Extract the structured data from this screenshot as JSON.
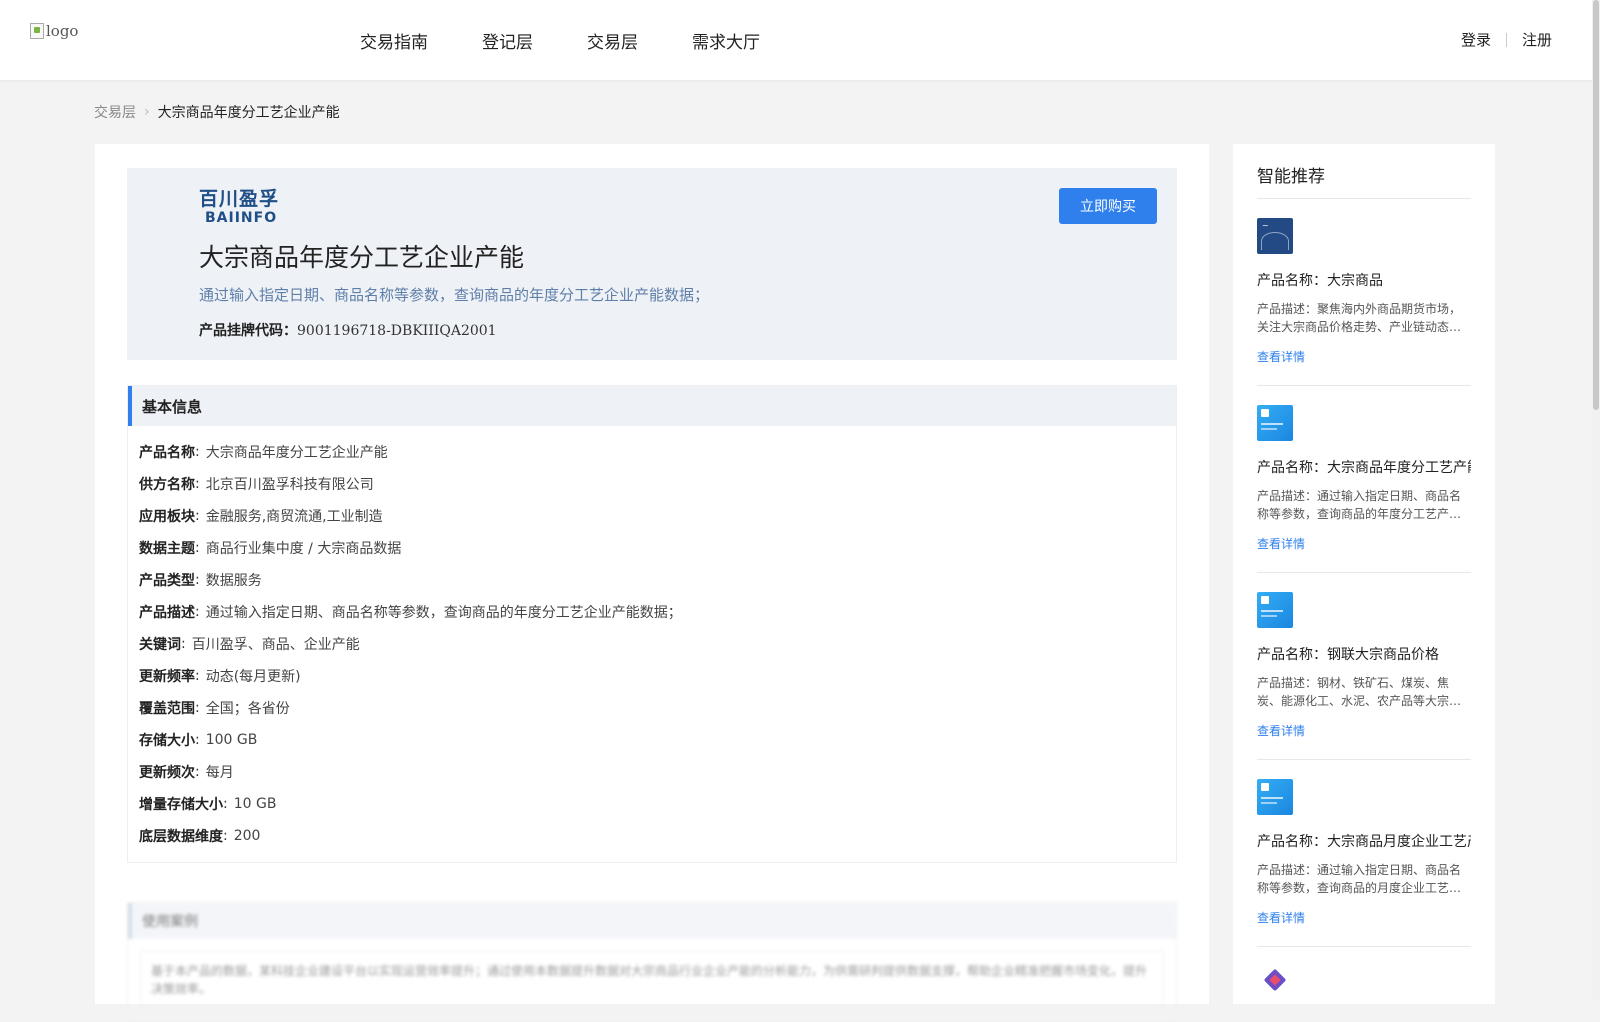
{
  "header": {
    "logo_alt": "logo",
    "nav": [
      "交易指南",
      "登记层",
      "交易层",
      "需求大厅"
    ],
    "login": "登录",
    "register": "注册"
  },
  "breadcrumb": {
    "parent": "交易层",
    "current": "大宗商品年度分工艺企业产能"
  },
  "product": {
    "brand_cn": "百川盈孚",
    "brand_en": "BAIINFO",
    "title": "大宗商品年度分工艺企业产能",
    "subtitle": "通过输入指定日期、商品名称等参数，查询商品的年度分工艺企业产能数据；",
    "code_label": "产品挂牌代码：",
    "code_value": "9001196718-DBKIIIQA2001",
    "buy_label": "立即购买"
  },
  "basic_info": {
    "title": "基本信息",
    "rows": [
      {
        "label": "产品名称",
        "value": "大宗商品年度分工艺企业产能"
      },
      {
        "label": "供方名称",
        "value": "北京百川盈孚科技有限公司"
      },
      {
        "label": "应用板块",
        "value": "金融服务,商贸流通,工业制造"
      },
      {
        "label": "数据主题",
        "value": "商品行业集中度 / 大宗商品数据"
      },
      {
        "label": "产品类型",
        "value": "数据服务"
      },
      {
        "label": "产品描述",
        "value": "通过输入指定日期、商品名称等参数，查询商品的年度分工艺企业产能数据；"
      },
      {
        "label": "关键词",
        "value": "百川盈孚、商品、企业产能"
      },
      {
        "label": "更新频率",
        "value": "动态(每月更新)"
      },
      {
        "label": "覆盖范围",
        "value": "全国；各省份"
      },
      {
        "label": "存储大小",
        "value": "100 GB"
      },
      {
        "label": "更新频次",
        "value": "每月"
      },
      {
        "label": "增量存储大小",
        "value": "10 GB"
      },
      {
        "label": "底层数据维度",
        "value": "200"
      }
    ]
  },
  "usage_section": {
    "title": "使用案例",
    "text": "基于本产品的数据，某科技企业建设平台以实现运营效率提升；通过使用本数据提升数据对大宗商品行业企业产能的分析能力，为供需研判提供数据支撑，帮助企业精准把握市场变化，提升决策效率。"
  },
  "sidebar": {
    "title": "智能推荐",
    "more_label": "查看详情",
    "items": [
      {
        "name": "产品名称：大宗商品",
        "desc": "产品描述：聚焦海内外商品期货市场，关注大宗商品价格走势、产业链动态…",
        "thumb": "dark"
      },
      {
        "name": "产品名称：大宗商品年度分工艺产能",
        "desc": "产品描述：通过输入指定日期、商品名称等参数，查询商品的年度分工艺产…",
        "thumb": "blue"
      },
      {
        "name": "产品名称：钢联大宗商品价格",
        "desc": "产品描述：钢材、铁矿石、煤炭、焦炭、能源化工、水泥、农产品等大宗…",
        "thumb": "blue"
      },
      {
        "name": "产品名称：大宗商品月度企业工艺产能",
        "desc": "产品描述：通过输入指定日期、商品名称等参数，查询商品的月度企业工艺…",
        "thumb": "blue"
      }
    ]
  },
  "colors": {
    "accent": "#2f80ed",
    "brand": "#1f4f86",
    "hero_bg": "#eef2f7",
    "page_bg": "#f3f3f3"
  }
}
